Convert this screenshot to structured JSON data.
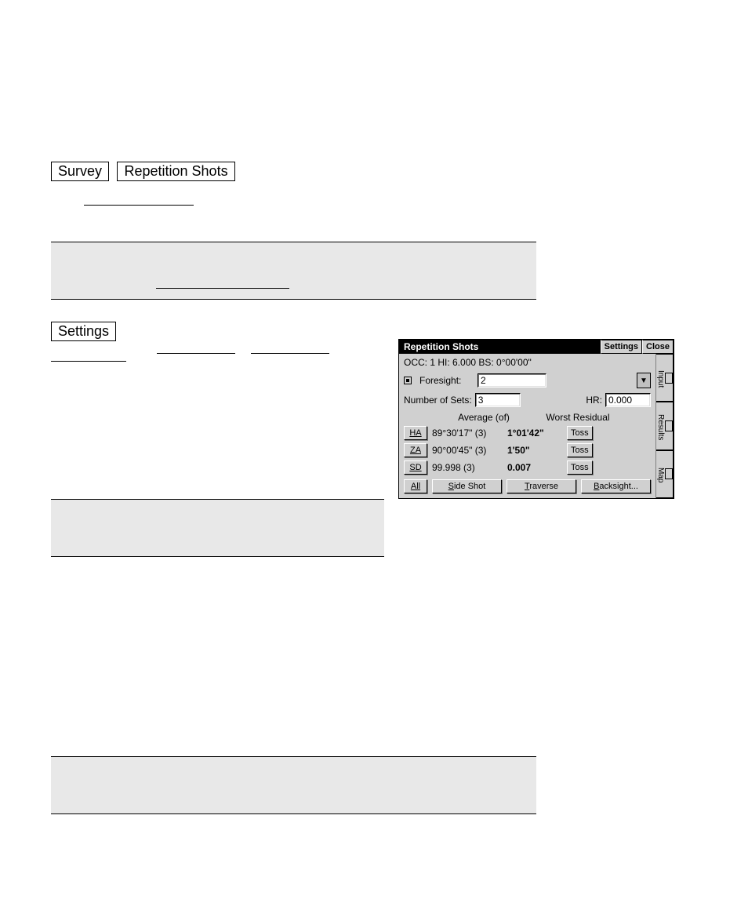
{
  "doc": {
    "survey_btn": "Survey",
    "rep_btn": "Repetition Shots",
    "settings_btn": "Settings"
  },
  "app": {
    "title": "Repetition Shots",
    "settings": "Settings",
    "close": "Close",
    "status": "OCC: 1  HI: 6.000  BS: 0°00'00\"",
    "foresight_label": "Foresight:",
    "foresight_value": "2",
    "numsets_label": "Number of Sets:",
    "numsets_value": "3",
    "hr_label": "HR:",
    "hr_value": "0.000",
    "avg_header": "Average (of)",
    "res_header": "Worst Residual",
    "rows": [
      {
        "key": "HA",
        "avg": "89°30'17\" (3)",
        "res": "1°01'42\"",
        "toss": "Toss"
      },
      {
        "key": "ZA",
        "avg": "90°00'45\" (3)",
        "res": "1'50\"",
        "toss": "Toss"
      },
      {
        "key": "SD",
        "avg": "99.998 (3)",
        "res": "0.007",
        "toss": "Toss"
      }
    ],
    "all": "All",
    "side": "Side Shot",
    "trav": "Traverse",
    "bs": "Backsight...",
    "tabs": {
      "input": "Input",
      "results": "Results",
      "map": "Map"
    }
  }
}
